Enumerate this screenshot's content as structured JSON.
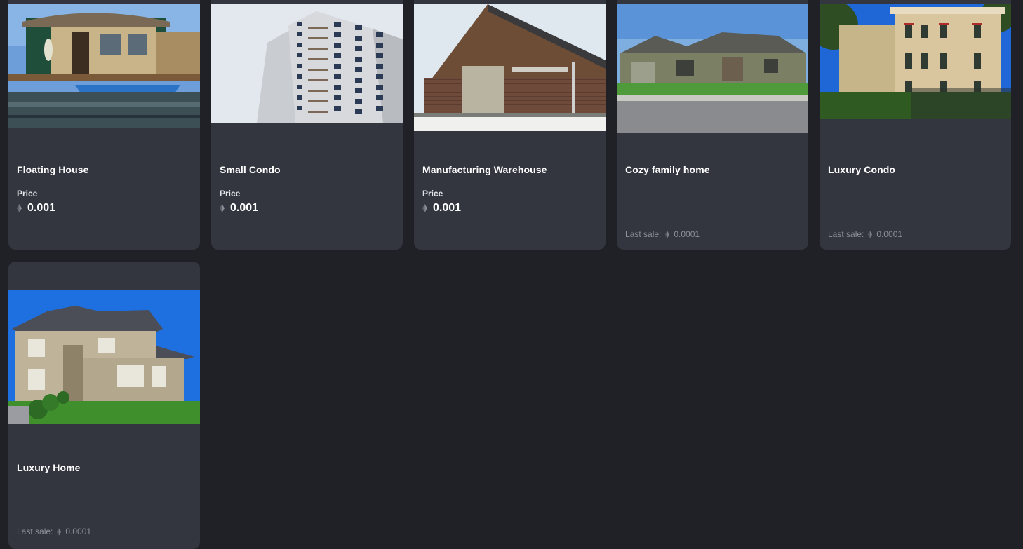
{
  "colors": {
    "page_background": "#202126",
    "card_background": "#33353f",
    "title_text": "#ffffff",
    "muted_text": "#8d8f99"
  },
  "currency_icon": "ethereum-icon",
  "listings": [
    {
      "title": "Floating House",
      "price_label": "Price",
      "price": "0.001"
    },
    {
      "title": "Small Condo",
      "price_label": "Price",
      "price": "0.001"
    },
    {
      "title": "Manufacturing Warehouse",
      "price_label": "Price",
      "price": "0.001"
    },
    {
      "title": "Cozy family home",
      "last_sale_label": "Last sale:",
      "last_sale": "0.0001"
    },
    {
      "title": "Luxury Condo",
      "last_sale_label": "Last sale:",
      "last_sale": "0.0001"
    },
    {
      "title": "Luxury Home",
      "last_sale_label": "Last sale:",
      "last_sale": "0.0001"
    }
  ]
}
